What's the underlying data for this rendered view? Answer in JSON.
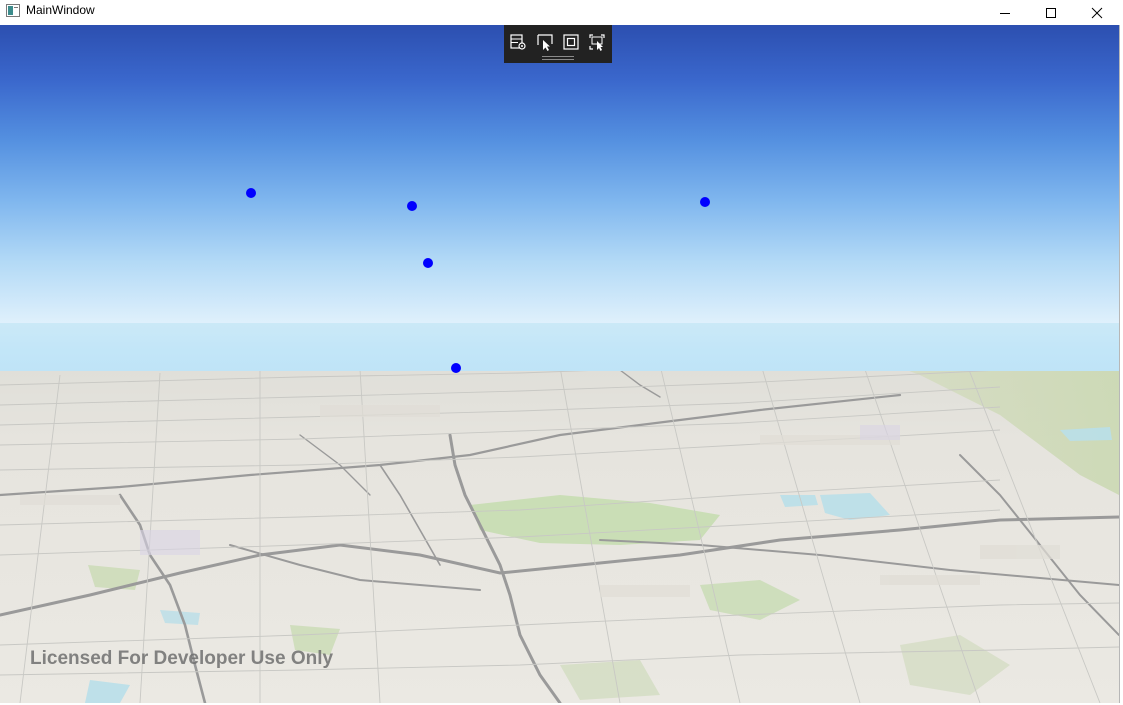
{
  "window": {
    "title": "MainWindow",
    "controls": [
      "minimize-icon",
      "maximize-icon",
      "close-icon"
    ]
  },
  "toolbar": {
    "tools": [
      {
        "name": "add-feature-tool",
        "icon": "table-gear-icon"
      },
      {
        "name": "select-tool",
        "icon": "pointer-select-icon"
      },
      {
        "name": "zoom-extent-tool",
        "icon": "square-frame-icon"
      },
      {
        "name": "select-area-tool",
        "icon": "area-select-icon"
      }
    ]
  },
  "scene": {
    "point_color": "#0000ff",
    "points": [
      "graphic-point-1",
      "graphic-point-2",
      "graphic-point-3",
      "graphic-point-4",
      "graphic-point-5"
    ],
    "watermark": "Licensed For Developer Use Only"
  },
  "colors": {
    "sky_top": "#2c4fb0",
    "sky_horizon": "#e2f2fc",
    "ocean": "#c3e6f8",
    "land": "#eae8e2",
    "toolbar_bg": "#222222"
  }
}
